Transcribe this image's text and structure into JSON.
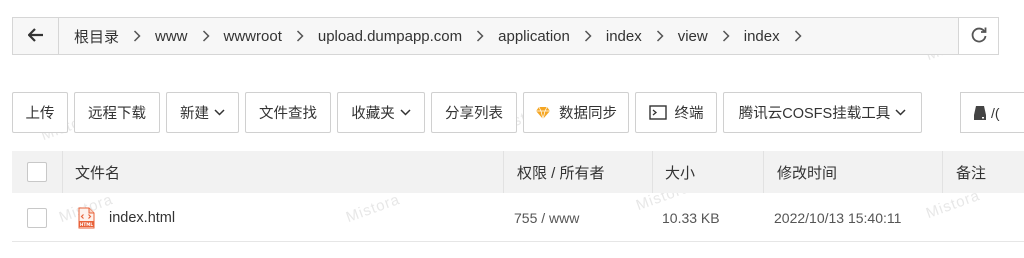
{
  "pathbar": {
    "crumbs": [
      "根目录",
      "www",
      "wwwroot",
      "upload.dumpapp.com",
      "application",
      "index",
      "view",
      "index"
    ]
  },
  "toolbar": {
    "upload": "上传",
    "remote_download": "远程下载",
    "new": "新建",
    "file_search": "文件查找",
    "favorites": "收藏夹",
    "share_list": "分享列表",
    "data_sync": "数据同步",
    "terminal": "终端",
    "cosfs_tool": "腾讯云COSFS挂载工具",
    "last_partial": "/("
  },
  "table": {
    "columns": {
      "name": "文件名",
      "perm_owner": "权限 / 所有者",
      "size": "大小",
      "mtime": "修改时间",
      "note": "备注"
    },
    "rows": [
      {
        "name": "index.html",
        "perm_owner": "755 / www",
        "size": "10.33 KB",
        "mtime": "2022/10/13 15:40:11",
        "icon_label": "HTML"
      }
    ]
  },
  "watermark": "Mistora",
  "colors": {
    "file_icon": "#e8623a",
    "sync_icon": "#f5a623"
  }
}
